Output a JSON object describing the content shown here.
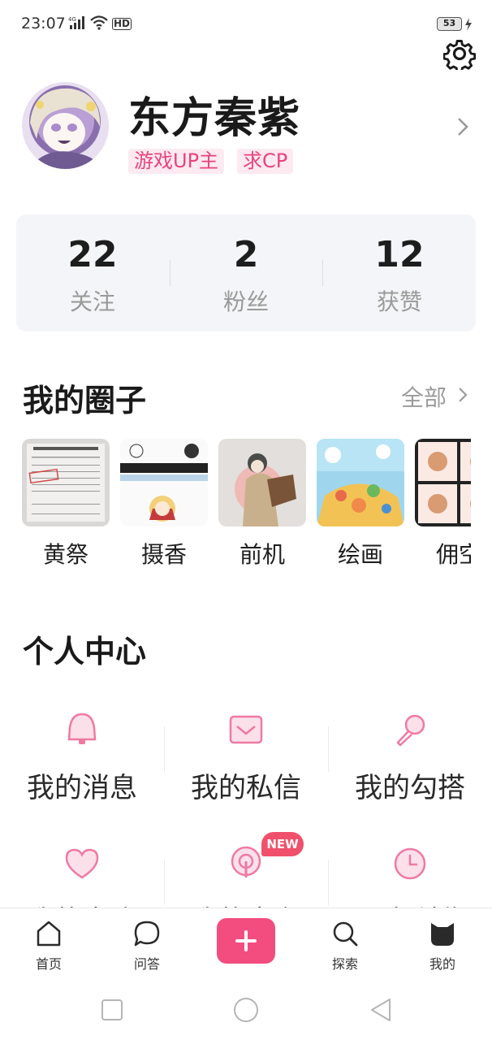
{
  "status_bar": {
    "time": "23:07",
    "network": "4G",
    "hd": "HD",
    "battery": "53"
  },
  "profile": {
    "name": "东方秦紫",
    "tags": [
      "游戏UP主",
      "求CP"
    ]
  },
  "stats": [
    {
      "value": "22",
      "label": "关注"
    },
    {
      "value": "2",
      "label": "粉丝"
    },
    {
      "value": "12",
      "label": "获赞"
    }
  ],
  "circles": {
    "title": "我的圈子",
    "see_all": "全部",
    "items": [
      {
        "label": "黄祭"
      },
      {
        "label": "摄香"
      },
      {
        "label": "前机"
      },
      {
        "label": "绘画"
      },
      {
        "label": "佣空"
      }
    ]
  },
  "personal_center": {
    "title": "个人中心",
    "items": [
      {
        "label": "我的消息",
        "icon": "bell-icon"
      },
      {
        "label": "我的私信",
        "icon": "envelope-icon"
      },
      {
        "label": "我的勾搭",
        "icon": "microphone-icon"
      },
      {
        "label": "我的喜欢",
        "icon": "heart-icon"
      },
      {
        "label": "我的电台",
        "icon": "radio-icon"
      },
      {
        "label": "历史浏览",
        "icon": "clock-icon"
      }
    ],
    "new_badge": "NEW"
  },
  "tabbar": {
    "items": [
      {
        "label": "首页",
        "icon": "home-icon"
      },
      {
        "label": "问答",
        "icon": "chat-bubble-icon"
      },
      {
        "label": "探索",
        "icon": "search-icon"
      },
      {
        "label": "我的",
        "icon": "cat-face-icon"
      }
    ],
    "post_icon": "plus-icon"
  },
  "colors": {
    "accent": "#f34d7f",
    "tag_bg": "#fdeaf1",
    "tag_text": "#e9437a",
    "icon_pink": "#ef7aa0",
    "badge": "#f0506b"
  }
}
